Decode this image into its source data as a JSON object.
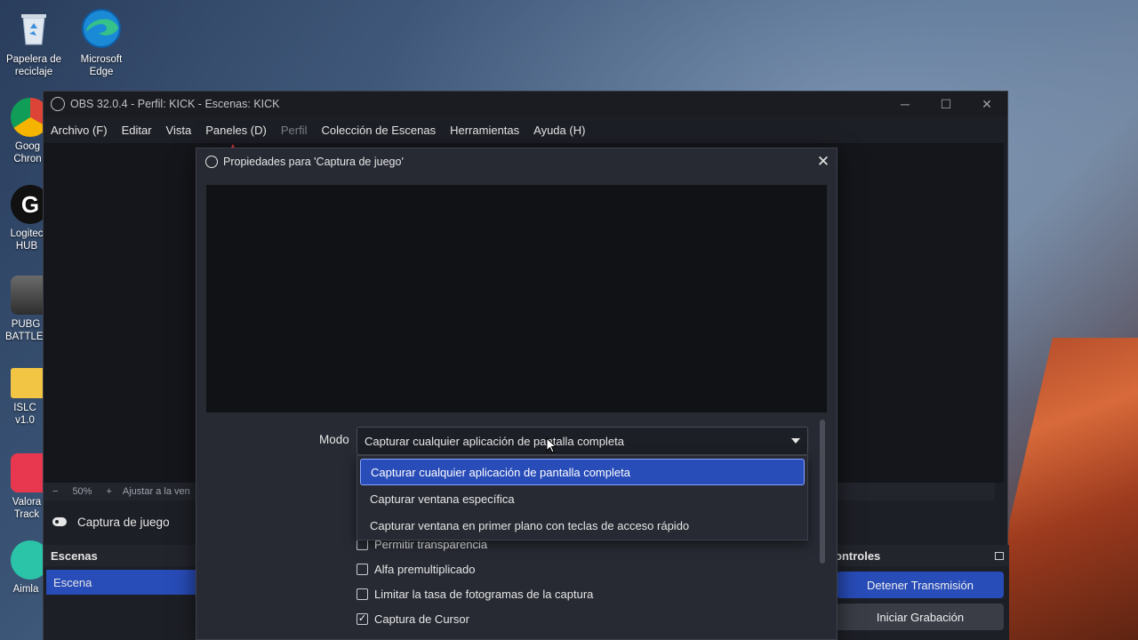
{
  "desktop": {
    "icons": [
      {
        "label": "Papelera de reciclaje",
        "icon": "recycle-bin-icon"
      },
      {
        "label": "Microsoft Edge",
        "icon": "edge-icon"
      }
    ],
    "partial_icons": [
      {
        "label": "Goog Chron",
        "icon": "chrome-icon"
      },
      {
        "label": "Logitec HUB",
        "icon": "logitech-icon"
      },
      {
        "label": "PUBG BATTLEG",
        "icon": "pubg-icon"
      },
      {
        "label": "ISLC v1.0",
        "icon": "folder-icon"
      },
      {
        "label": "Valora Track",
        "icon": "valorant-tracker-icon"
      },
      {
        "label": "Aimla",
        "icon": "aimlab-icon"
      }
    ]
  },
  "obs": {
    "title": "OBS 32.0.4 - Perfil: KICK - Escenas: KICK",
    "menu": [
      {
        "label": "Archivo (F)",
        "disabled": false
      },
      {
        "label": "Editar",
        "disabled": false
      },
      {
        "label": "Vista",
        "disabled": false
      },
      {
        "label": "Paneles (D)",
        "disabled": false
      },
      {
        "label": "Perfil",
        "disabled": true
      },
      {
        "label": "Colección de Escenas",
        "disabled": false
      },
      {
        "label": "Herramientas",
        "disabled": false
      },
      {
        "label": "Ayuda (H)",
        "disabled": false
      }
    ],
    "zoom": {
      "minus": "−",
      "value": "50%",
      "plus": "+",
      "fit": "Ajustar a la ven"
    },
    "source_name": "Captura de juego",
    "scenes": {
      "title": "Escenas",
      "items": [
        "Escena"
      ]
    },
    "controls": {
      "title": "ontroles",
      "stream_button": "Detener Transmisión",
      "record_button": "Iniciar Grabación"
    }
  },
  "dialog": {
    "title": "Propiedades para 'Captura de juego'",
    "mode_label": "Modo",
    "mode_value": "Capturar cualquier aplicación de pantalla completa",
    "options": [
      "Capturar cualquier aplicación de pantalla completa",
      "Capturar ventana específica",
      "Capturar ventana en primer plano con teclas de acceso rápido"
    ],
    "checkboxes": [
      {
        "label": "Permitir transparencia",
        "checked": false
      },
      {
        "label": "Alfa premultiplicado",
        "checked": false
      },
      {
        "label": "Limitar la tasa de fotogramas de la captura",
        "checked": false
      },
      {
        "label": "Captura de Cursor",
        "checked": true
      }
    ]
  },
  "colors": {
    "accent": "#284cb8",
    "window_bg": "#1d1f26",
    "dialog_bg": "#272a33"
  }
}
